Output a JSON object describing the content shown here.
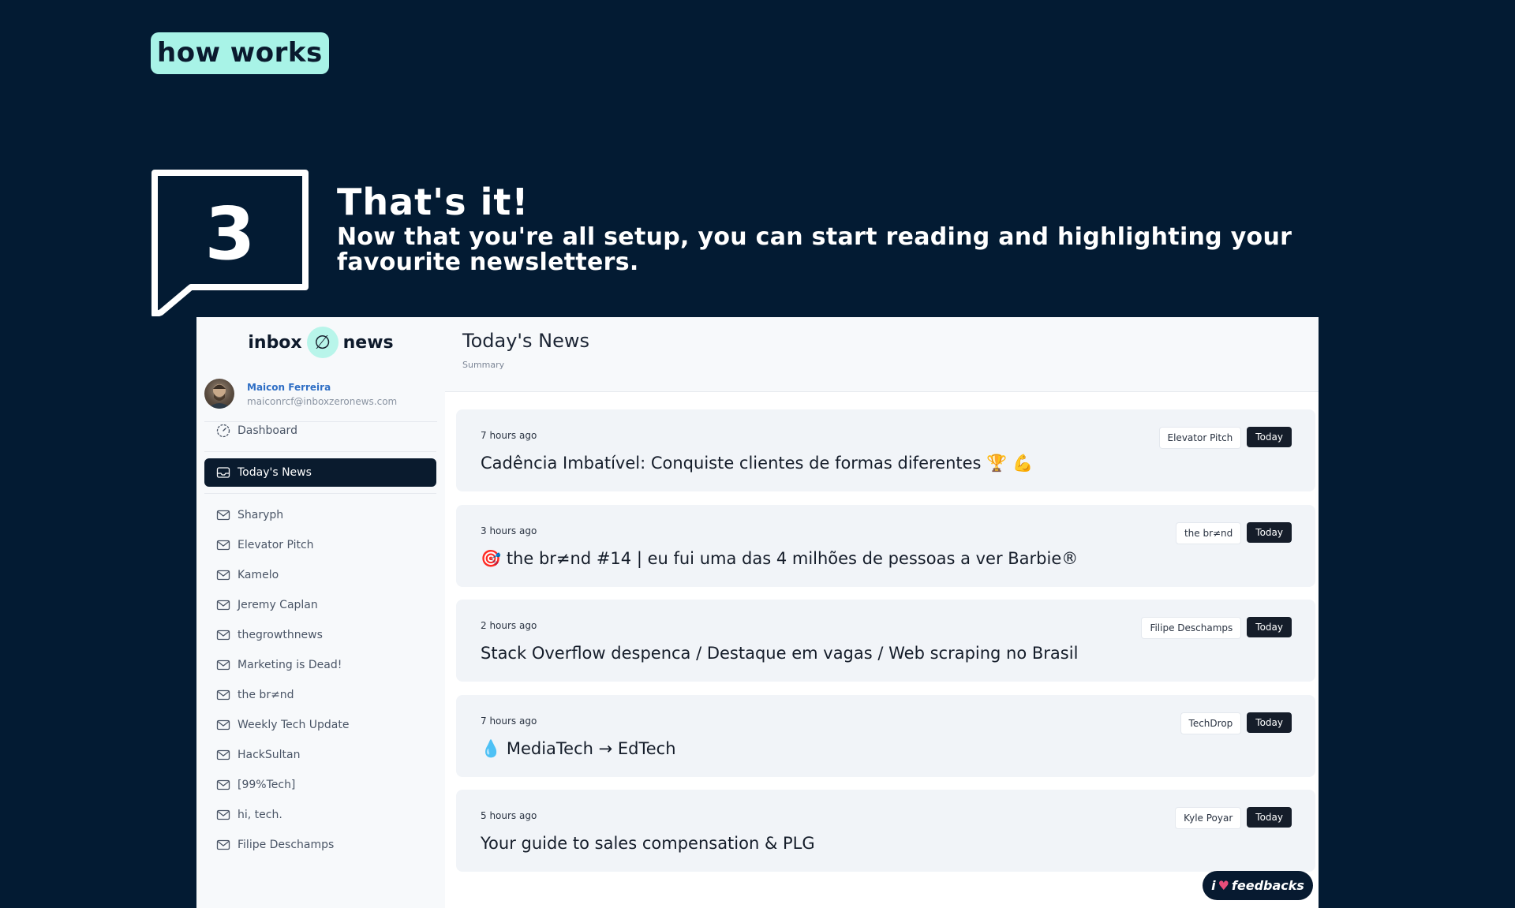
{
  "header": {
    "pill_label": "how works"
  },
  "step": {
    "number": "3",
    "title": "That's it!",
    "description": "Now that you're all setup, you can start reading and highlighting your favourite newsletters."
  },
  "app": {
    "logo": {
      "left": "inbox",
      "mark": "∅",
      "right": "news"
    },
    "user": {
      "name": "Maicon Ferreira",
      "email": "maiconrcf@inboxzeronews.com"
    },
    "nav": {
      "dashboard": "Dashboard",
      "todays_news": "Today's News",
      "newsletters": [
        "Sharyph",
        "Elevator Pitch",
        "Kamelo",
        "Jeremy Caplan",
        "thegrowthnews",
        "Marketing is Dead!",
        "the br≠nd",
        "Weekly Tech Update",
        "HackSultan",
        "[99%Tech]",
        "hi, tech.",
        "Filipe Deschamps"
      ]
    },
    "main": {
      "title": "Today's News",
      "subtitle": "Summary",
      "cards": [
        {
          "time": "7 hours ago",
          "title": "Cadência Imbatível: Conquiste clientes de formas diferentes 🏆 💪",
          "source": "Elevator Pitch",
          "badge": "Today"
        },
        {
          "time": "3 hours ago",
          "title": "🎯 the br≠nd #14 | eu fui uma das 4 milhões de pessoas a ver Barbie®",
          "source": "the br≠nd",
          "badge": "Today"
        },
        {
          "time": "2 hours ago",
          "title": "Stack Overflow despenca / Destaque em vagas / Web scraping no Brasil",
          "source": "Filipe Deschamps",
          "badge": "Today"
        },
        {
          "time": "7 hours ago",
          "title": "💧 MediaTech → EdTech",
          "source": "TechDrop",
          "badge": "Today"
        },
        {
          "time": "5 hours ago",
          "title": "Your guide to sales compensation & PLG",
          "source": "Kyle Poyar",
          "badge": "Today"
        }
      ]
    },
    "feedback": {
      "prefix": "i",
      "heart": "♥",
      "label": "feedbacks"
    }
  },
  "colors": {
    "background": "#031b33",
    "accent": "#a8f3e7",
    "active_nav": "#0a1b2e"
  },
  "icons": {
    "nav_dashboard": "gauge-icon",
    "nav_inbox": "inbox-icon",
    "nav_newsletter": "mail-icon"
  }
}
